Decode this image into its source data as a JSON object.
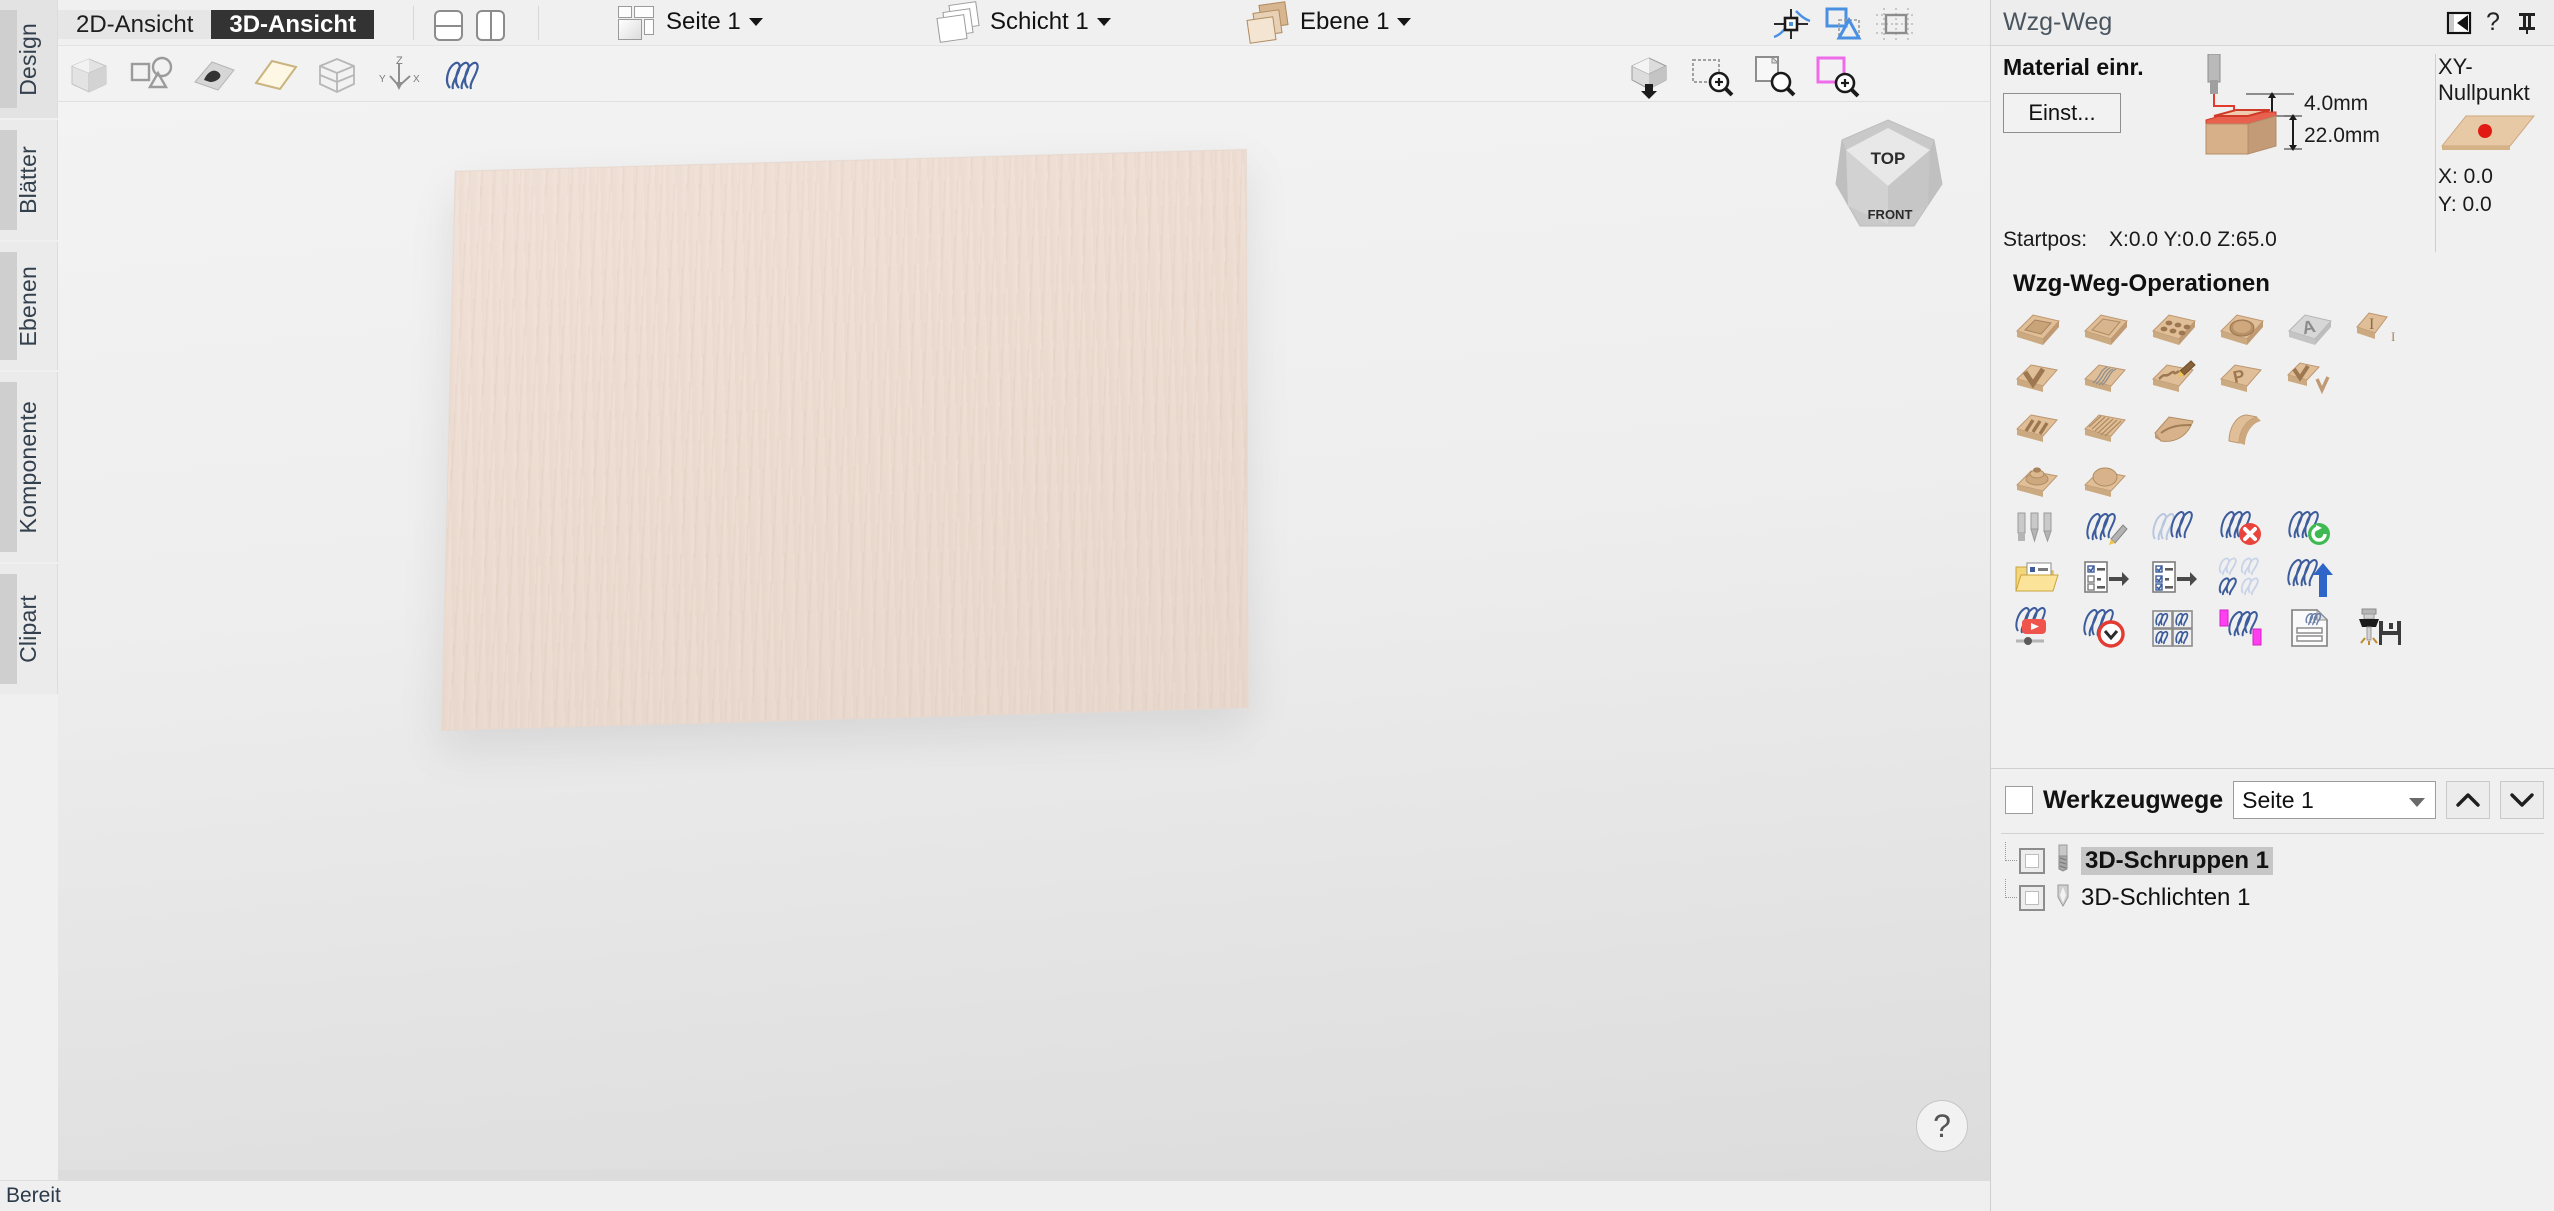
{
  "app": {
    "status_text": "Bereit"
  },
  "left_rail": {
    "items": [
      {
        "label": "Design",
        "selected": true
      },
      {
        "label": "Blätter",
        "selected": false
      },
      {
        "label": "Ebenen",
        "selected": false
      },
      {
        "label": "Komponente",
        "selected": false
      },
      {
        "label": "Clipart",
        "selected": false
      }
    ]
  },
  "topbar": {
    "view_tabs": [
      {
        "label": "2D-Ansicht",
        "active": false
      },
      {
        "label": "3D-Ansicht",
        "active": true
      }
    ],
    "split_horizontal_title": "split-horizontal",
    "split_vertical_title": "split-vertical",
    "page_selector": {
      "label": "Seite 1"
    },
    "sheet_selector": {
      "label": "Schicht 1"
    },
    "layer_selector": {
      "label": "Ebene 1"
    },
    "right_icons": [
      "snap-node-icon",
      "snap-shape-icon",
      "snap-grid-icon"
    ]
  },
  "toolbar2": {
    "icons": [
      "solid-model-icon",
      "vector-shapes-icon",
      "component-preview-icon",
      "flat-plane-icon",
      "wireframe-box-icon",
      "axis-orientation-icon",
      "toolpath-preview-icon"
    ],
    "right_icons": [
      "isometric-view-icon",
      "zoom-selection-icon",
      "zoom-drawing-icon",
      "zoom-material-icon"
    ]
  },
  "viewport": {
    "view_cube": {
      "top_label": "TOP",
      "front_label": "FRONT"
    },
    "help_label": "?",
    "material_color": "#f0e0d6"
  },
  "right_panel": {
    "title": "Wzg-Weg",
    "titlebar_icons": [
      "collapse-panel-icon",
      "help-icon",
      "pin-icon"
    ],
    "help_label": "?",
    "material_setup": {
      "title": "Material einr.",
      "settings_button": "Einst...",
      "clearance_value": "4.0mm",
      "thickness_value": "22.0mm",
      "startpos_label": "Startpos:",
      "startpos_value": "X:0.0 Y:0.0 Z:65.0"
    },
    "xy_origin": {
      "title": "XY-Nullpunkt",
      "x_label": "X: 0.0",
      "y_label": "Y: 0.0"
    },
    "operations": {
      "title": "Wzg-Weg-Operationen",
      "rows": [
        [
          "profile-toolpath-icon",
          "pocket-toolpath-icon",
          "drilling-toolpath-icon",
          "fluting-toolpath-icon",
          "quick-engrave-icon",
          "inlay-toolpath-icon"
        ],
        [
          "vcarve-toolpath-icon",
          "prism-carve-icon",
          "texture-toolpath-icon",
          "prism-profile-icon",
          "chamfer-toolpath-icon"
        ],
        [
          "3d-rough-toolpath-icon",
          "3d-finish-toolpath-icon",
          "3d-fluting-icon",
          "moulding-toolpath-icon"
        ],
        [
          "rotary-rough-icon",
          "rotary-finish-icon"
        ],
        [
          "tool-database-icon",
          "edit-toolpath-icon",
          "duplicate-toolpath-icon",
          "delete-toolpath-icon",
          "recalculate-toolpath-icon"
        ],
        [
          "open-toolpath-folder-icon",
          "save-toolpath-icon",
          "save-all-toolpaths-icon",
          "toolpath-tiling-icon",
          "merge-toolpath-icon"
        ],
        [
          "preview-toolpath-icon",
          "estimate-time-icon",
          "toolpath-sheets-icon",
          "toolpath-boundary-icon",
          "toolpath-summary-icon",
          "save-machine-file-icon"
        ]
      ]
    },
    "toolpaths": {
      "header_label": "Werkzeugwege",
      "sheet_select_value": "Seite 1",
      "move_up_label": "▲",
      "move_down_label": "▼",
      "items": [
        {
          "name": "3D-Schruppen 1",
          "icon": "endmill-icon",
          "selected": true,
          "checked": false
        },
        {
          "name": "3D-Schlichten 1",
          "icon": "ballnose-icon",
          "selected": false,
          "checked": false
        }
      ]
    }
  }
}
